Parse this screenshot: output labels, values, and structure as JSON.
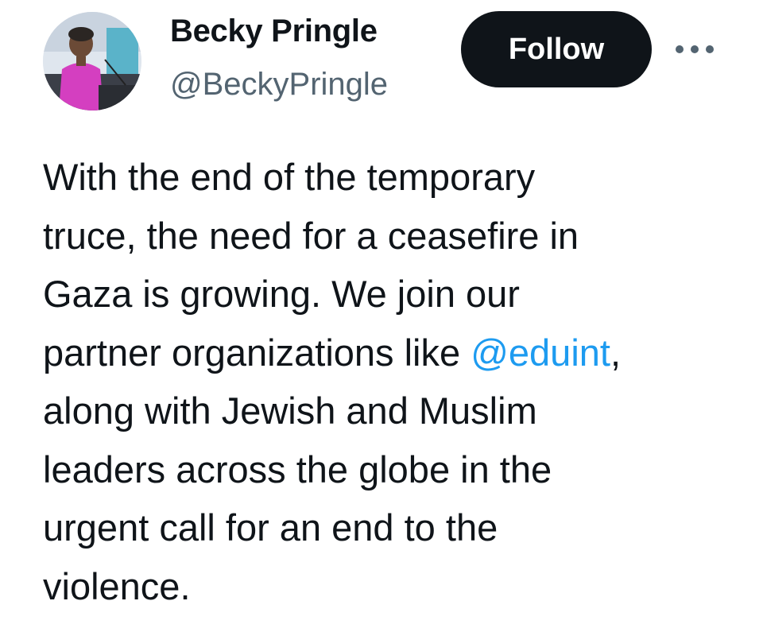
{
  "author": {
    "display_name": "Becky Pringle",
    "handle": "@BeckyPringle",
    "avatar_icon": "profile-photo"
  },
  "follow_label": "Follow",
  "more_icon": "more-horizontal-icon",
  "tweet": {
    "lines": [
      "With the end of the temporary",
      "truce, the need for a ceasefire in",
      "Gaza is growing. We join our",
      "partner organizations like ",
      "along with Jewish and Muslim",
      "leaders across the globe in the",
      "urgent call for an end to the",
      "violence."
    ],
    "mention": "@eduint",
    "mention_suffix": ","
  },
  "colors": {
    "text": "#0f1419",
    "secondary_text": "#536471",
    "link": "#1d9bf0",
    "button_bg": "#0f1419"
  }
}
